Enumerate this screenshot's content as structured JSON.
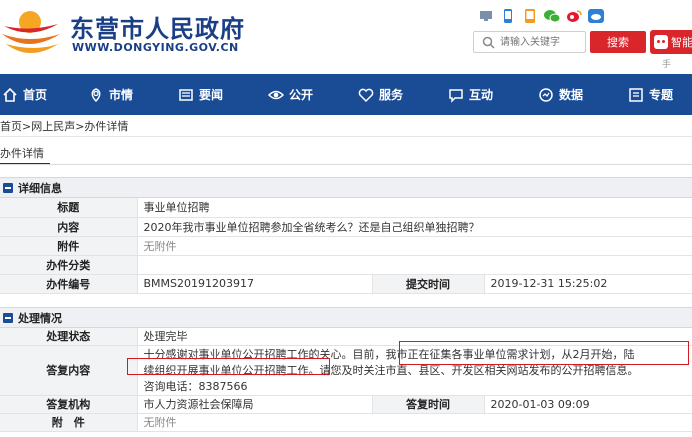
{
  "header": {
    "site_title": "东营市人民政府",
    "site_domain": "WWW.DONGYING.GOV.CN",
    "search_placeholder": "请输入关键字",
    "search_button": "搜索",
    "smart_button": "智能",
    "smart_sub": "手",
    "social_icons": [
      "pc-icon",
      "phone-icon",
      "app-icon",
      "wechat-icon",
      "weibo-icon",
      "cloud-icon"
    ]
  },
  "nav": [
    {
      "label": "首页",
      "icon": "home-icon"
    },
    {
      "label": "市情",
      "icon": "city-icon"
    },
    {
      "label": "要闻",
      "icon": "news-icon"
    },
    {
      "label": "公开",
      "icon": "eye-icon"
    },
    {
      "label": "服务",
      "icon": "heart-icon"
    },
    {
      "label": "互动",
      "icon": "chat-icon"
    },
    {
      "label": "数据",
      "icon": "data-icon"
    },
    {
      "label": "专题",
      "icon": "topic-icon"
    }
  ],
  "breadcrumb": "首页>网上民声>办件详情",
  "section_tab": "办件详情",
  "detail": {
    "heading": "详细信息",
    "title_label": "标题",
    "title_value": "事业单位招聘",
    "content_label": "内容",
    "content_value": "2020年我市事业单位招聘参加全省统考么？还是自己组织单独招聘？",
    "attach_label": "附件",
    "attach_value": "无附件",
    "category_label": "办件分类",
    "category_value": "",
    "number_label": "办件编号",
    "number_value": "BMMS20191203917",
    "submit_label": "提交时间",
    "submit_value": "2019-12-31 15:25:02"
  },
  "process": {
    "heading": "处理情况",
    "status_label": "处理状态",
    "status_value": "处理完毕",
    "reply_label": "答复内容",
    "reply_line1": "十分感谢对事业单位公开招聘工作的关心。目前，我市正在征集各事业单位需求计划，从2月开始，陆",
    "reply_line2": "续组织开展事业单位公开招聘工作。请您及时关注市直、县区、开发区相关网站发布的公开招聘信息。",
    "reply_line3": "咨询电话：8387566",
    "org_label": "答复机构",
    "org_value": "市人力资源社会保障局",
    "time_label": "答复时间",
    "time_value": "2020-01-03 09:09",
    "attach_label": "附　件",
    "attach_value": "无附件"
  },
  "colors": {
    "brand_blue": "#1a4c95",
    "title_blue": "#1a3f86",
    "accent_red": "#d9262b"
  }
}
